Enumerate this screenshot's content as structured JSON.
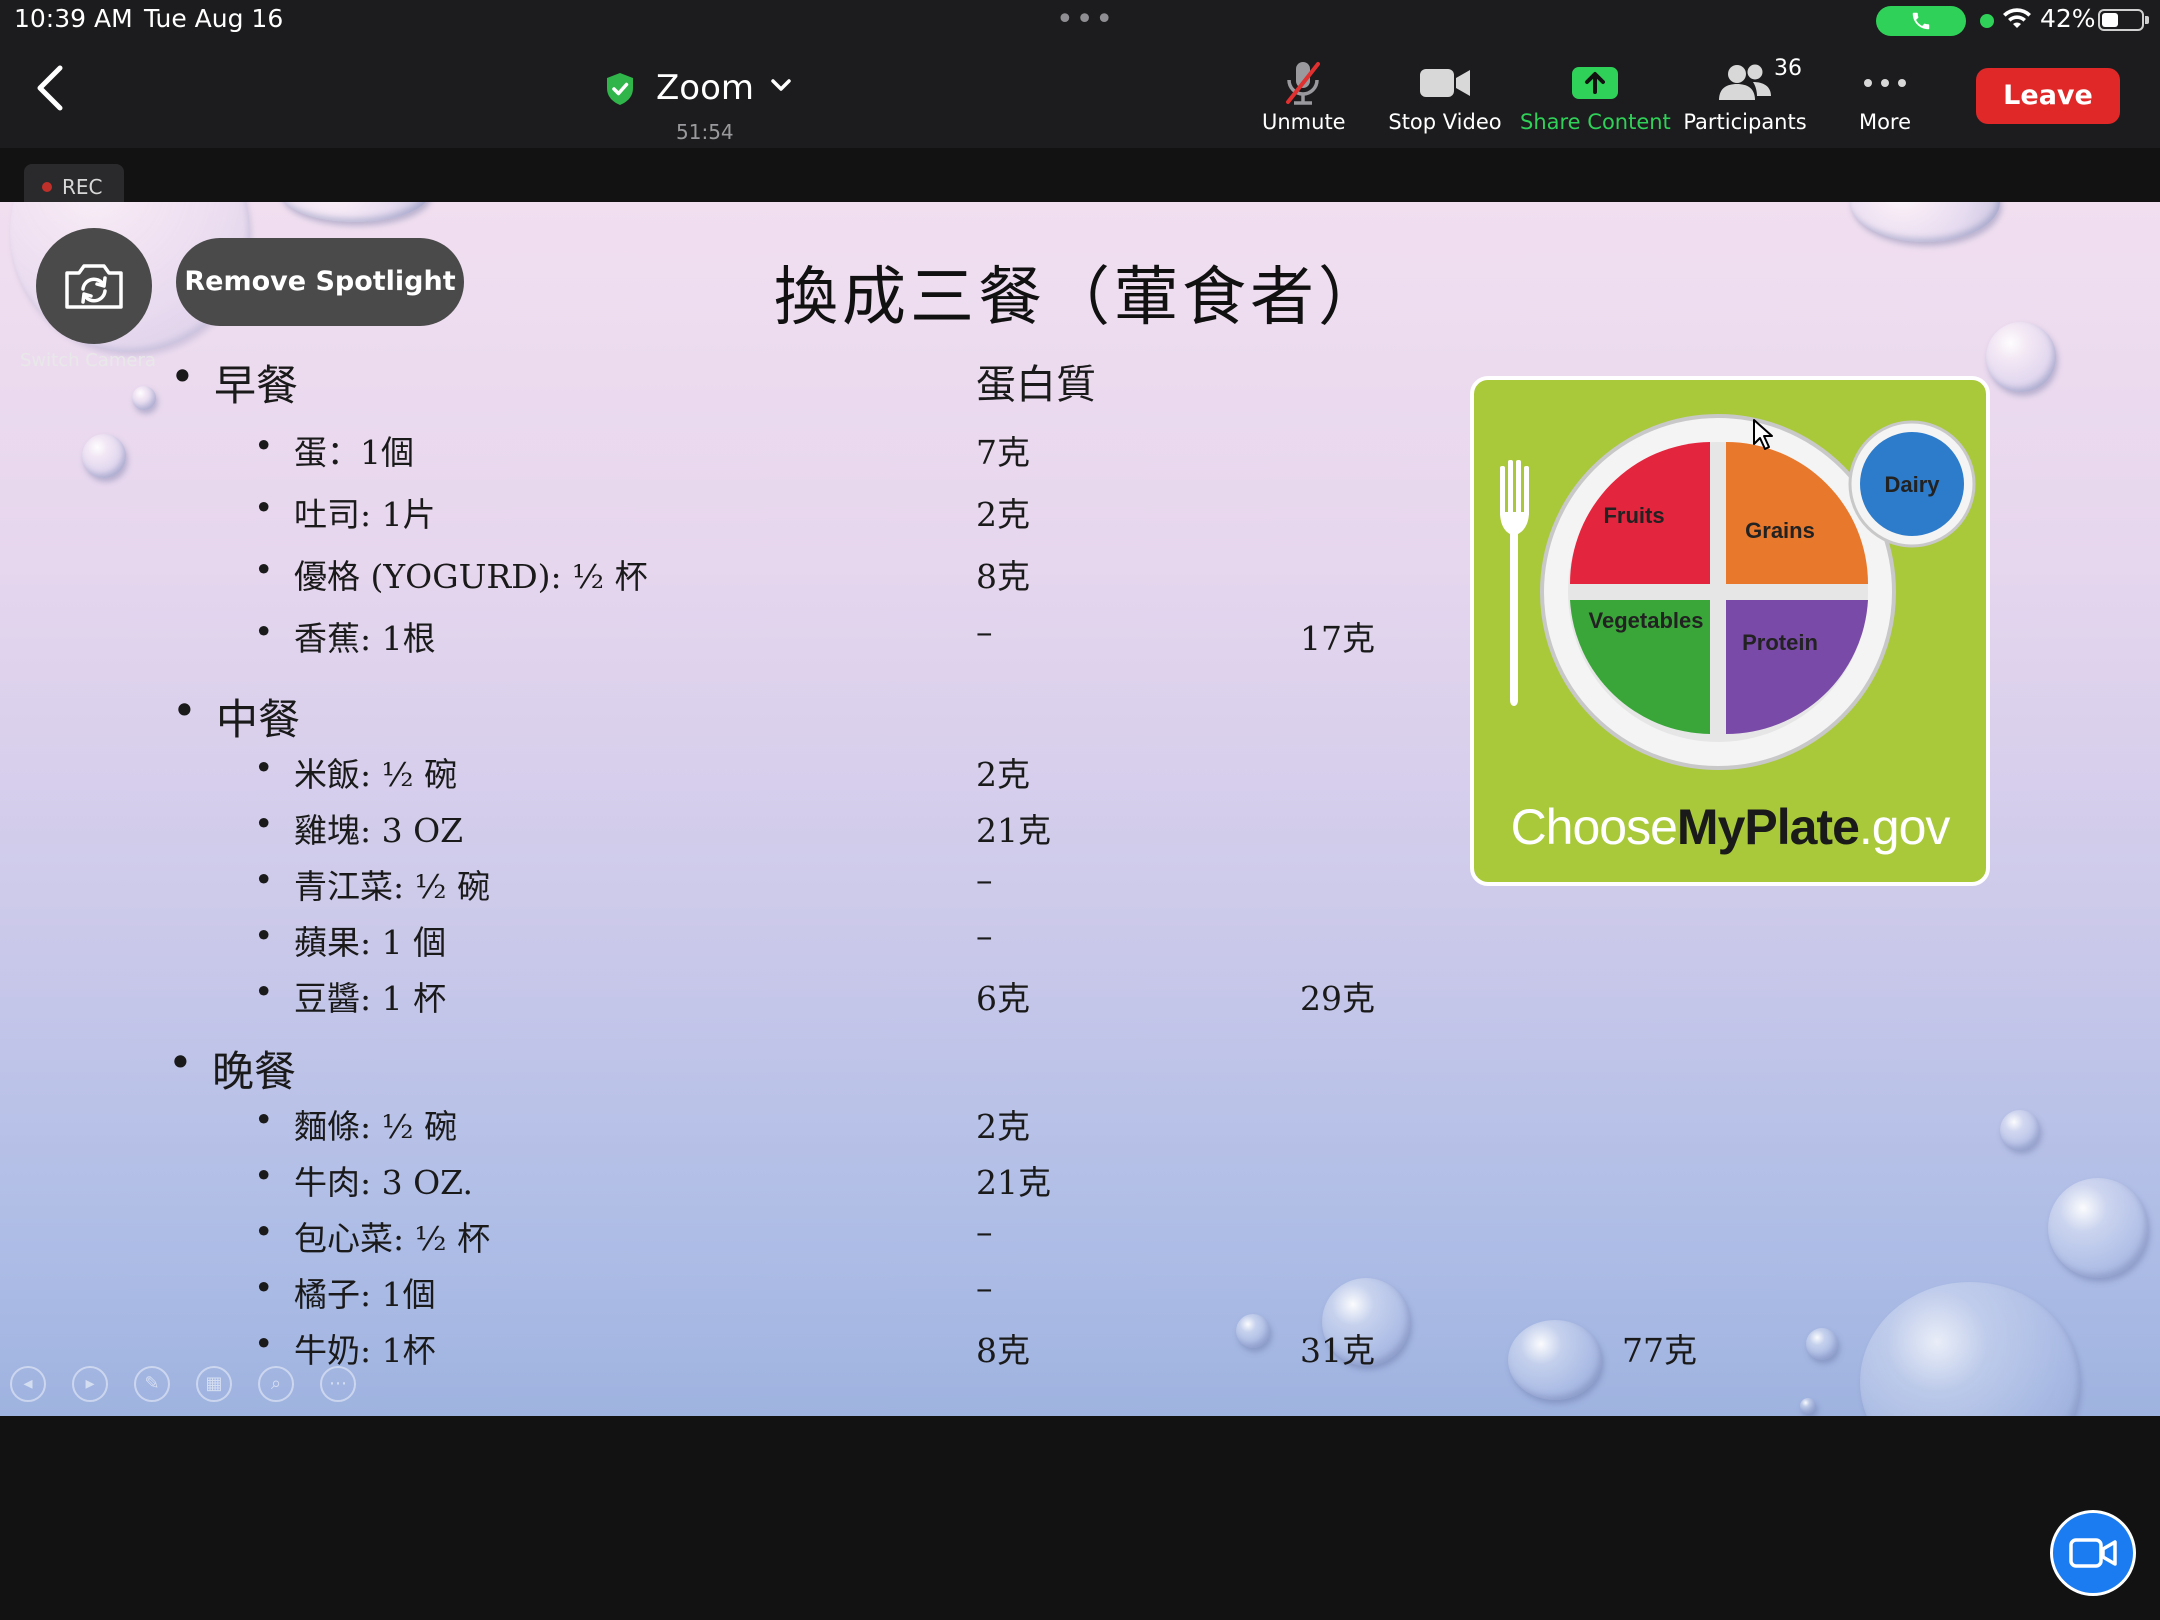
{
  "status_bar": {
    "time": "10:39 AM",
    "date": "Tue Aug 16",
    "battery_percent": "42%",
    "battery_level": 0.42
  },
  "toolbar": {
    "meeting_title": "Zoom",
    "meeting_timer": "51:54",
    "unmute_label": "Unmute",
    "stop_video_label": "Stop Video",
    "share_content_label": "Share Content",
    "participants_label": "Participants",
    "participants_count": "36",
    "more_label": "More",
    "leave_label": "Leave"
  },
  "rec": {
    "label": "REC"
  },
  "overlay": {
    "switch_camera_label": "Switch Camera",
    "remove_spotlight_label": "Remove Spotlight"
  },
  "slide": {
    "title": "換成三餐（葷食者）",
    "protein_header": "蛋白質",
    "meals": [
      {
        "heading": "早餐",
        "items": [
          {
            "name": "蛋：1個",
            "protein": "7克"
          },
          {
            "name": "吐司: 1片",
            "protein": "2克"
          },
          {
            "name": "優格 (YOGURD): ½ 杯",
            "protein": "8克"
          },
          {
            "name": "香蕉: 1根",
            "protein": "–"
          }
        ],
        "subtotal": "17克"
      },
      {
        "heading": "中餐",
        "items": [
          {
            "name": "米飯: ½ 碗",
            "protein": "2克"
          },
          {
            "name": "雞塊: 3 OZ",
            "protein": "21克"
          },
          {
            "name": "青江菜: ½ 碗",
            "protein": "–"
          },
          {
            "name": "蘋果: 1 個",
            "protein": "–"
          },
          {
            "name": "豆醬: 1 杯",
            "protein": "6克"
          }
        ],
        "subtotal": "29克"
      },
      {
        "heading": "晚餐",
        "items": [
          {
            "name": "麵條: ½ 碗",
            "protein": "2克"
          },
          {
            "name": "牛肉: 3 OZ.",
            "protein": "21克"
          },
          {
            "name": "包心菜: ½ 杯",
            "protein": "–"
          },
          {
            "name": "橘子: 1個",
            "protein": "–"
          },
          {
            "name": "牛奶: 1杯",
            "protein": "8克"
          }
        ],
        "subtotal": "31克",
        "grand_total": "77克"
      }
    ],
    "myplate": {
      "fruits": "Fruits",
      "grains": "Grains",
      "vegetables": "Vegetables",
      "protein": "Protein",
      "dairy": "Dairy",
      "logo_prefix": "Choose",
      "logo_bold": "MyPlate",
      "logo_suffix": ".gov"
    }
  },
  "colors": {
    "leave": "#e02828",
    "share_green": "#30d158",
    "toolbar_bg": "#1c1c1e",
    "fab_blue": "#1a7cf0"
  }
}
